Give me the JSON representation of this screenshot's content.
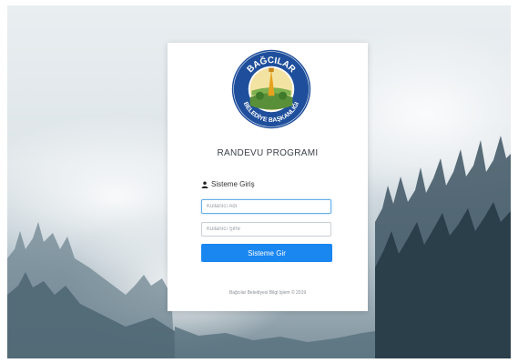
{
  "logo": {
    "top_text": "BAĞCILAR",
    "bottom_text": "BELEDİYE BAŞKANLIĞI"
  },
  "app_title": "RANDEVU PROGRAMI",
  "login": {
    "label": "Sisteme Giriş",
    "icon": "user-icon",
    "username": {
      "value": "",
      "placeholder": "Kullanıcı Adı"
    },
    "password": {
      "value": "",
      "placeholder": "Kullanıcı Şifre"
    },
    "submit_label": "Sisteme Gir"
  },
  "footer": "Bağcılar Belediyesi Bilgi İşlem © 2019",
  "colors": {
    "accent": "#1a86f0",
    "text": "#3b3f45"
  }
}
